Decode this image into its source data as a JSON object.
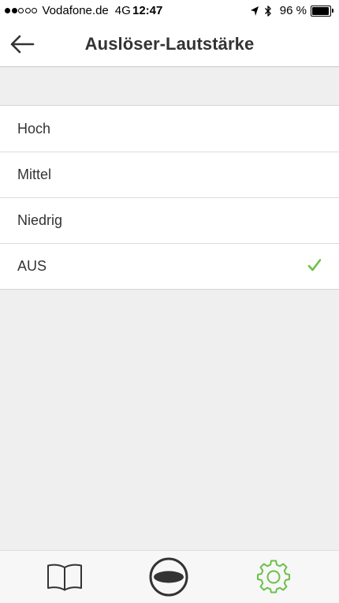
{
  "status_bar": {
    "signal_filled": 2,
    "signal_total": 5,
    "carrier": "Vodafone.de",
    "network": "4G",
    "time": "12:47",
    "battery_percent": "96 %",
    "battery_level": 0.96
  },
  "header": {
    "back_icon": "arrow-left-icon",
    "title": "Auslöser-Lautstärke"
  },
  "options": [
    {
      "label": "Hoch",
      "selected": false
    },
    {
      "label": "Mittel",
      "selected": false
    },
    {
      "label": "Niedrig",
      "selected": false
    },
    {
      "label": "AUS",
      "selected": true
    }
  ],
  "tab_bar": {
    "tabs": [
      {
        "icon": "book-icon",
        "active": false
      },
      {
        "icon": "shutter-trigger-icon",
        "active": false
      },
      {
        "icon": "gear-icon",
        "active": true
      }
    ]
  },
  "colors": {
    "accent_green": "#6cc04a",
    "background": "#efefef",
    "text": "#333333"
  }
}
